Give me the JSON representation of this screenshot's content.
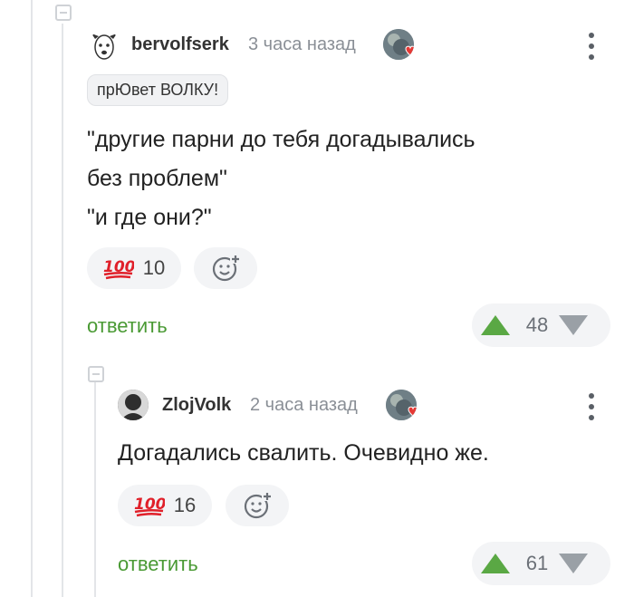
{
  "comments": [
    {
      "username": "bervolfserk",
      "time": "3 часа назад",
      "badge": "прЮвет ВОЛКУ!",
      "text_lines": [
        "\"другие парни до тебя догадывались",
        "без проблем\"",
        "\"и где они?\""
      ],
      "reaction_count": "10",
      "reply_label": "ответить",
      "rating": "48",
      "icons": {
        "avatar": "dog-avatar-icon",
        "reaction": "hundred-points-icon",
        "add_reaction": "add-reaction-icon",
        "menu": "more-vertical-icon"
      }
    },
    {
      "username": "ZlojVolk",
      "time": "2 часа назад",
      "text_lines": [
        "Догадались свалить. Очевидно же."
      ],
      "reaction_count": "16",
      "reply_label": "ответить",
      "rating": "61",
      "icons": {
        "avatar": "user-avatar-icon",
        "reaction": "hundred-points-icon",
        "add_reaction": "add-reaction-icon",
        "menu": "more-vertical-icon"
      }
    }
  ],
  "colors": {
    "accent_green": "#4a9a34",
    "upvote": "#5aa844",
    "downvote": "#9aa0a6",
    "heart": "#e53935"
  }
}
